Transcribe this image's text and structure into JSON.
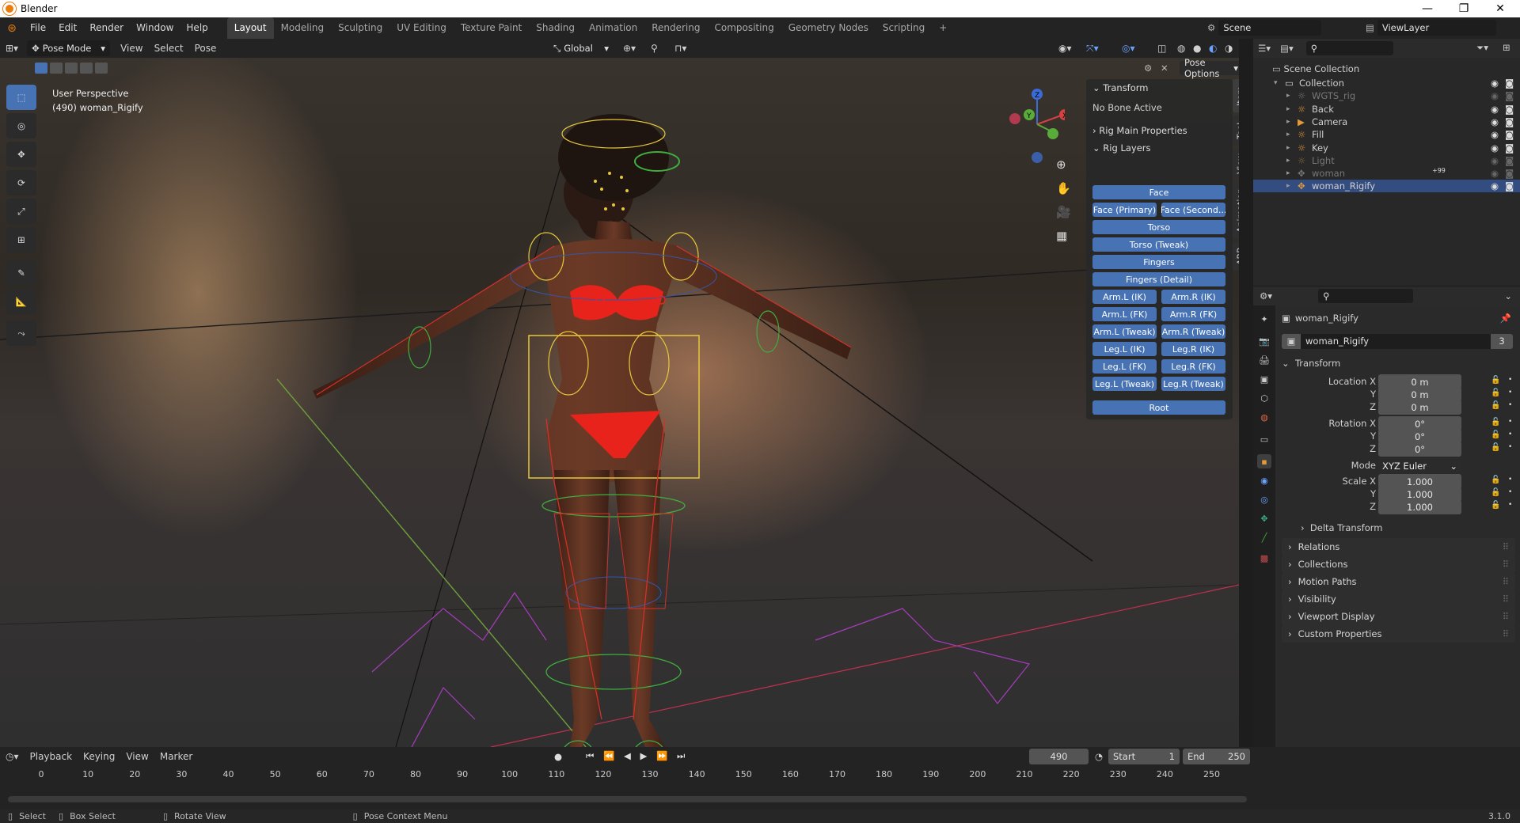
{
  "window": {
    "title": "Blender"
  },
  "topbar": {
    "menus": [
      "File",
      "Edit",
      "Render",
      "Window",
      "Help"
    ],
    "workspaces": [
      "Layout",
      "Modeling",
      "Sculpting",
      "UV Editing",
      "Texture Paint",
      "Shading",
      "Animation",
      "Rendering",
      "Compositing",
      "Geometry Nodes",
      "Scripting"
    ],
    "active_workspace": "Layout",
    "add_tab": "+",
    "scene": "Scene",
    "view_layer": "ViewLayer"
  },
  "viewport": {
    "mode": "Pose Mode",
    "menus": [
      "View",
      "Select",
      "Pose"
    ],
    "orientation": "Global",
    "pose_options": "Pose Options",
    "overlay_text": {
      "perspective": "User Perspective",
      "object": "(490) woman_Rigify"
    },
    "gizmo_axes": {
      "x": "X",
      "y": "Y",
      "z": "Z"
    }
  },
  "n_panel": {
    "transform_header": "Transform",
    "no_bone": "No Bone Active",
    "rig_main_header": "Rig Main Properties",
    "rig_layers_header": "Rig Layers",
    "buttons": {
      "face": "Face",
      "face_primary": "Face (Primary)",
      "face_secondary": "Face (Second...",
      "torso": "Torso",
      "torso_tweak": "Torso (Tweak)",
      "fingers": "Fingers",
      "fingers_detail": "Fingers (Detail)",
      "arm_l_ik": "Arm.L (IK)",
      "arm_r_ik": "Arm.R (IK)",
      "arm_l_fk": "Arm.L (FK)",
      "arm_r_fk": "Arm.R (FK)",
      "arm_l_tweak": "Arm.L (Tweak)",
      "arm_r_tweak": "Arm.R (Tweak)",
      "leg_l_ik": "Leg.L (IK)",
      "leg_r_ik": "Leg.R (IK)",
      "leg_l_fk": "Leg.L (FK)",
      "leg_r_fk": "Leg.R (FK)",
      "leg_l_tweak": "Leg.L (Tweak)",
      "leg_r_tweak": "Leg.R (Tweak)",
      "root": "Root"
    },
    "side_tabs": [
      "Item",
      "Tool",
      "View",
      "Animation",
      "ARP"
    ]
  },
  "outliner": {
    "scene_collection": "Scene Collection",
    "items": [
      {
        "name": "Collection",
        "dim": false
      },
      {
        "name": "WGTS_rig",
        "dim": true
      },
      {
        "name": "Back",
        "dim": false
      },
      {
        "name": "Camera",
        "dim": false
      },
      {
        "name": "Fill",
        "dim": false
      },
      {
        "name": "Key",
        "dim": false
      },
      {
        "name": "Light",
        "dim": true
      },
      {
        "name": "woman",
        "dim": true
      },
      {
        "name": "woman_Rigify",
        "dim": false
      }
    ],
    "badge": "+99"
  },
  "properties": {
    "object_name": "woman_Rigify",
    "data_name": "woman_Rigify",
    "users": "3",
    "transform_header": "Transform",
    "location": {
      "label": "Location X",
      "x": "0 m",
      "y": "0 m",
      "z": "0 m"
    },
    "rotation": {
      "label": "Rotation X",
      "x": "0°",
      "y": "0°",
      "z": "0°"
    },
    "mode_label": "Mode",
    "mode_value": "XYZ Euler",
    "scale": {
      "label": "Scale X",
      "x": "1.000",
      "y": "1.000",
      "z": "1.000"
    },
    "axis_y": "Y",
    "axis_z": "Z",
    "delta": "Delta Transform",
    "sections": [
      "Relations",
      "Collections",
      "Motion Paths",
      "Visibility",
      "Viewport Display",
      "Custom Properties"
    ]
  },
  "timeline": {
    "menus": [
      "Playback",
      "Keying",
      "View",
      "Marker"
    ],
    "current_frame": "490",
    "start_label": "Start",
    "start": "1",
    "end_label": "End",
    "end": "250",
    "ticks": [
      "0",
      "10",
      "20",
      "30",
      "40",
      "50",
      "60",
      "70",
      "80",
      "90",
      "100",
      "110",
      "120",
      "130",
      "140",
      "150",
      "160",
      "170",
      "180",
      "190",
      "200",
      "210",
      "220",
      "230",
      "240",
      "250"
    ]
  },
  "statusbar": {
    "select": "Select",
    "box_select": "Box Select",
    "rotate_view": "Rotate View",
    "pose_context": "Pose Context Menu",
    "version": "3.1.0"
  },
  "colors": {
    "accent": "#4772b3",
    "selection": "#334d80",
    "bone_red": "#e8241f",
    "bone_yellow": "#e6c73a",
    "bone_green": "#3fae3f"
  }
}
